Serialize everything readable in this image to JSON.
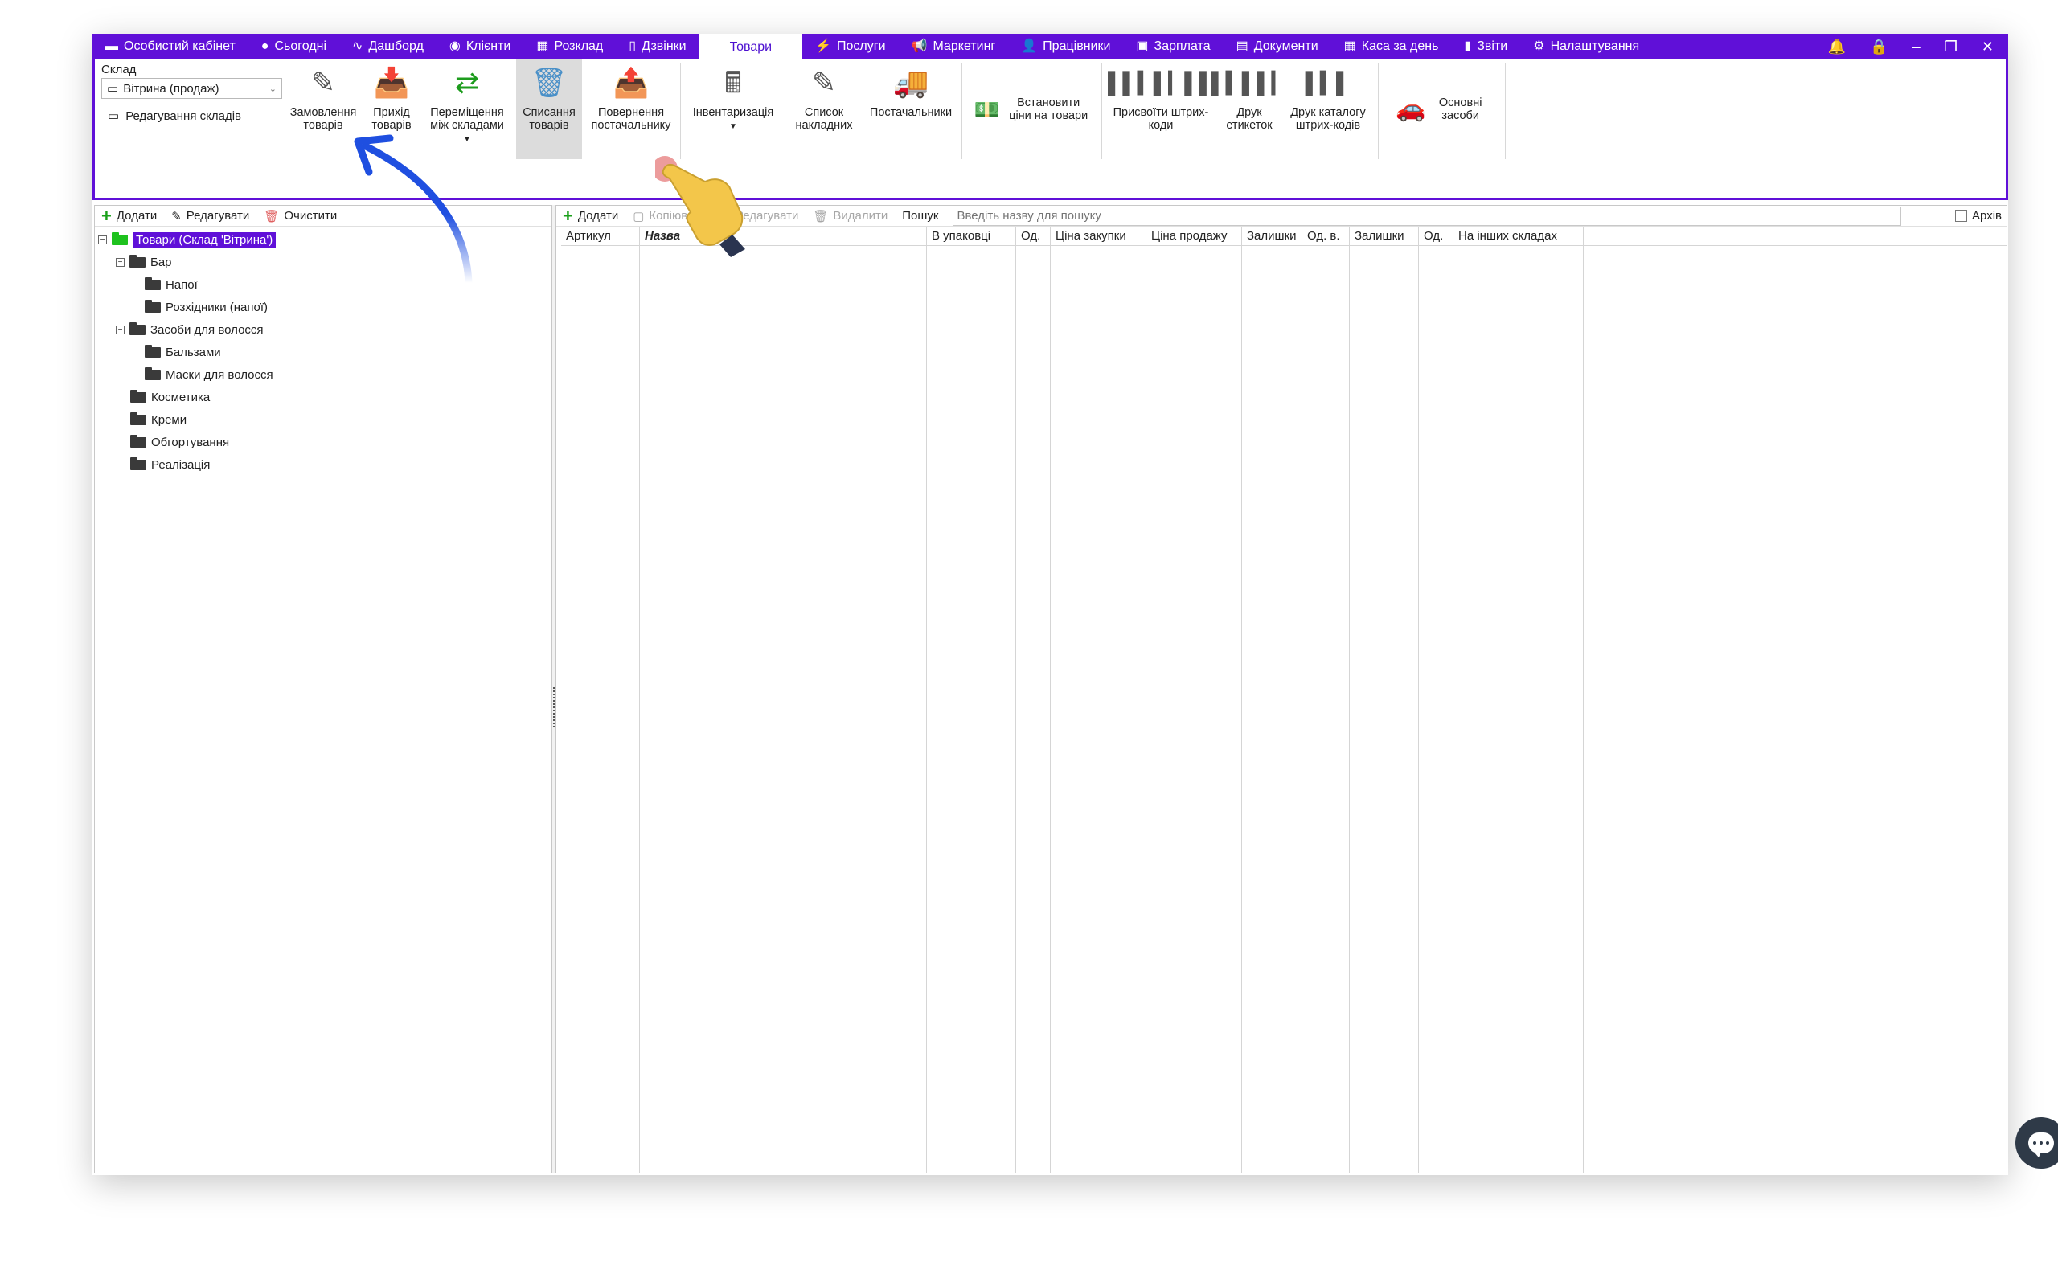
{
  "menu": {
    "items": [
      {
        "icon": "▬",
        "label": "Особистий кабінет",
        "name": "menu-personal-cabinet"
      },
      {
        "icon": "●",
        "label": "Сьогодні",
        "name": "menu-today"
      },
      {
        "icon": "∿",
        "label": "Дашборд",
        "name": "menu-dashboard"
      },
      {
        "icon": "◉",
        "label": "Клієнти",
        "name": "menu-clients"
      },
      {
        "icon": "▦",
        "label": "Розклад",
        "name": "menu-schedule"
      },
      {
        "icon": "▯",
        "label": "Дзвінки",
        "name": "menu-calls"
      },
      {
        "icon": "",
        "label": "Товари",
        "name": "menu-goods"
      },
      {
        "icon": "⚡",
        "label": "Послуги",
        "name": "menu-services"
      },
      {
        "icon": "📢",
        "label": "Маркетинг",
        "name": "menu-marketing"
      },
      {
        "icon": "👤",
        "label": "Працівники",
        "name": "menu-employees"
      },
      {
        "icon": "▣",
        "label": "Зарплата",
        "name": "menu-salary"
      },
      {
        "icon": "▤",
        "label": "Документи",
        "name": "menu-documents"
      },
      {
        "icon": "▦",
        "label": "Каса за день",
        "name": "menu-cash-day"
      },
      {
        "icon": "▮",
        "label": "Звіти",
        "name": "menu-reports"
      },
      {
        "icon": "⚙",
        "label": "Налаштування",
        "name": "menu-settings"
      }
    ],
    "active": "Товари"
  },
  "ribbon": {
    "warehouse_label": "Склад",
    "warehouse_value": "Вітрина (продаж)",
    "edit_warehouses": "Редагування складів",
    "buttons": {
      "order": "Замовлення товарів",
      "income": "Прихід товарів",
      "move": "Переміщення між складами",
      "writeoff": "Списання товарів",
      "return": "Повернення постачальнику",
      "inventory": "Інвентаризація",
      "invoices": "Список накладних",
      "suppliers": "Постачальники",
      "set_prices": "Встановити ціни на товари",
      "assign_barcodes": "Присвоїти штрих-коди",
      "print_labels": "Друк етикеток",
      "print_catalog": "Друк каталогу штрих-кодів",
      "fixed_assets": "Основні засоби"
    }
  },
  "left_toolbar": {
    "add": "Додати",
    "edit": "Редагувати",
    "clear": "Очистити"
  },
  "tree": {
    "root": "Товари (Склад 'Вітрина')",
    "nodes": [
      {
        "label": "Бар",
        "level": 1,
        "expandable": true
      },
      {
        "label": "Напої",
        "level": 2,
        "expandable": false
      },
      {
        "label": "Розхідники (напої)",
        "level": 2,
        "expandable": false
      },
      {
        "label": "Засоби для волосся",
        "level": 1,
        "expandable": true
      },
      {
        "label": "Бальзами",
        "level": 2,
        "expandable": false
      },
      {
        "label": "Маски для волосся",
        "level": 2,
        "expandable": false
      },
      {
        "label": "Косметика",
        "level": 1,
        "expandable": false
      },
      {
        "label": "Креми",
        "level": 1,
        "expandable": false
      },
      {
        "label": "Обгортування",
        "level": 1,
        "expandable": false
      },
      {
        "label": "Реалізація",
        "level": 1,
        "expandable": false
      }
    ]
  },
  "right_toolbar": {
    "add": "Додати",
    "copy": "Копіювати",
    "edit": "Редагувати",
    "delete": "Видалити",
    "search_label": "Пошук",
    "search_placeholder": "Введіть назву для пошуку",
    "archive": "Архів"
  },
  "grid": {
    "columns": [
      "Артикул",
      "Назва",
      "В упаковці",
      "Од.",
      "Ціна закупки",
      "Ціна продажу",
      "Залишки",
      "Од. в.",
      "Залишки",
      "Од.",
      "На інших складах"
    ]
  }
}
